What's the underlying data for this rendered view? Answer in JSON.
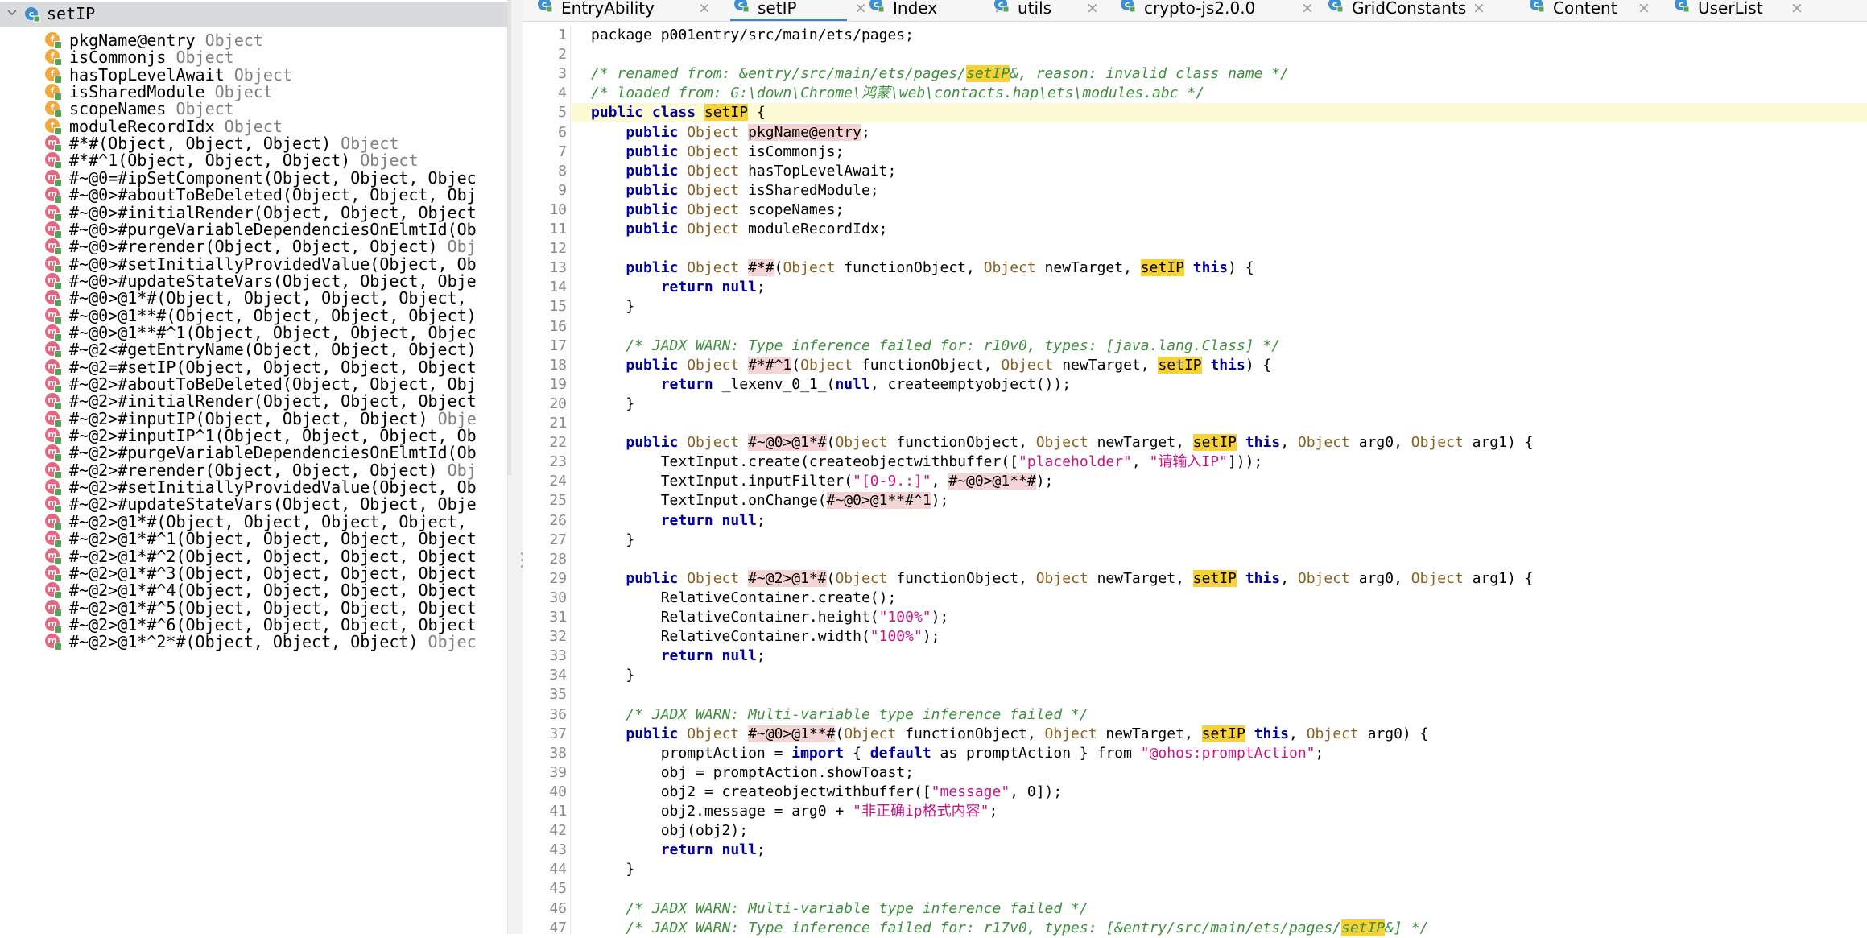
{
  "tree": {
    "root_label": "setIP",
    "items": [
      {
        "kind": "f",
        "name": "pkgName@entry",
        "type": "Object"
      },
      {
        "kind": "f",
        "name": "isCommonjs",
        "type": "Object"
      },
      {
        "kind": "f",
        "name": "hasTopLevelAwait",
        "type": "Object"
      },
      {
        "kind": "f",
        "name": "isSharedModule",
        "type": "Object"
      },
      {
        "kind": "f",
        "name": "scopeNames",
        "type": "Object"
      },
      {
        "kind": "f",
        "name": "moduleRecordIdx",
        "type": "Object"
      },
      {
        "kind": "m",
        "name": "#*#(Object, Object, Object)",
        "type": "Object"
      },
      {
        "kind": "m",
        "name": "#*#^1(Object, Object, Object)",
        "type": "Object"
      },
      {
        "kind": "m",
        "name": "#~@0=#ipSetComponent(Object, Object, Objec",
        "type": ""
      },
      {
        "kind": "m",
        "name": "#~@0>#aboutToBeDeleted(Object, Object, Obj",
        "type": ""
      },
      {
        "kind": "m",
        "name": "#~@0>#initialRender(Object, Object, Object",
        "type": ""
      },
      {
        "kind": "m",
        "name": "#~@0>#purgeVariableDependenciesOnElmtId(Ob",
        "type": ""
      },
      {
        "kind": "m",
        "name": "#~@0>#rerender(Object, Object, Object)",
        "type": "Obj"
      },
      {
        "kind": "m",
        "name": "#~@0>#setInitiallyProvidedValue(Object, Ob",
        "type": ""
      },
      {
        "kind": "m",
        "name": "#~@0>#updateStateVars(Object, Object, Obje",
        "type": ""
      },
      {
        "kind": "m",
        "name": "#~@0>@1*#(Object, Object, Object, Object,",
        "type": ""
      },
      {
        "kind": "m",
        "name": "#~@0>@1**#(Object, Object, Object, Object)",
        "type": ""
      },
      {
        "kind": "m",
        "name": "#~@0>@1**#^1(Object, Object, Object, Objec",
        "type": ""
      },
      {
        "kind": "m",
        "name": "#~@2<#getEntryName(Object, Object, Object)",
        "type": ""
      },
      {
        "kind": "m",
        "name": "#~@2=#setIP(Object, Object, Object, Object",
        "type": ""
      },
      {
        "kind": "m",
        "name": "#~@2>#aboutToBeDeleted(Object, Object, Obj",
        "type": ""
      },
      {
        "kind": "m",
        "name": "#~@2>#initialRender(Object, Object, Object",
        "type": ""
      },
      {
        "kind": "m",
        "name": "#~@2>#inputIP(Object, Object, Object)",
        "type": "Obje"
      },
      {
        "kind": "m",
        "name": "#~@2>#inputIP^1(Object, Object, Object, Ob",
        "type": ""
      },
      {
        "kind": "m",
        "name": "#~@2>#purgeVariableDependenciesOnElmtId(Ob",
        "type": ""
      },
      {
        "kind": "m",
        "name": "#~@2>#rerender(Object, Object, Object)",
        "type": "Obj"
      },
      {
        "kind": "m",
        "name": "#~@2>#setInitiallyProvidedValue(Object, Ob",
        "type": ""
      },
      {
        "kind": "m",
        "name": "#~@2>#updateStateVars(Object, Object, Obje",
        "type": ""
      },
      {
        "kind": "m",
        "name": "#~@2>@1*#(Object, Object, Object, Object,",
        "type": ""
      },
      {
        "kind": "m",
        "name": "#~@2>@1*#^1(Object, Object, Object, Object",
        "type": ""
      },
      {
        "kind": "m",
        "name": "#~@2>@1*#^2(Object, Object, Object, Object",
        "type": ""
      },
      {
        "kind": "m",
        "name": "#~@2>@1*#^3(Object, Object, Object, Object",
        "type": ""
      },
      {
        "kind": "m",
        "name": "#~@2>@1*#^4(Object, Object, Object, Object",
        "type": ""
      },
      {
        "kind": "m",
        "name": "#~@2>@1*#^5(Object, Object, Object, Object",
        "type": ""
      },
      {
        "kind": "m",
        "name": "#~@2>@1*#^6(Object, Object, Object, Object",
        "type": ""
      },
      {
        "kind": "m",
        "name": "#~@2>@1*^2*#(Object, Object, Object)",
        "type": "Objec"
      }
    ]
  },
  "tabs": [
    {
      "label": "EntryAbility",
      "active": false
    },
    {
      "label": "setIP",
      "active": true
    },
    {
      "label": "Index",
      "active": false
    },
    {
      "label": "utils",
      "active": false
    },
    {
      "label": "crypto-js2.0.0",
      "active": false
    },
    {
      "label": "GridConstants",
      "active": false
    },
    {
      "label": "Content",
      "active": false
    },
    {
      "label": "UserList",
      "active": false
    }
  ],
  "tab_close_glyph": "×",
  "editor": {
    "lines": [
      [
        {
          "t": "package p001entry/src/main/ets/pages;"
        }
      ],
      [],
      [
        {
          "c": "cm",
          "t": "/* renamed from: &entry/src/main/ets/pages/"
        },
        {
          "c": "cm hl",
          "t": "setIP"
        },
        {
          "c": "cm",
          "t": "&, reason: invalid class name */"
        }
      ],
      [
        {
          "c": "cm",
          "t": "/* loaded from: G:\\down\\Chrome\\鸿蒙\\web\\contacts.hap\\ets\\modules.abc */"
        }
      ],
      [
        {
          "c": "kw",
          "t": "public class "
        },
        {
          "c": "hl",
          "t": "setIP"
        },
        {
          "t": " {"
        }
      ],
      [
        {
          "t": "    "
        },
        {
          "c": "kw",
          "t": "public "
        },
        {
          "c": "ty",
          "t": "Object "
        },
        {
          "c": "pk",
          "t": "pkgName@entry"
        },
        {
          "t": ";"
        }
      ],
      [
        {
          "t": "    "
        },
        {
          "c": "kw",
          "t": "public "
        },
        {
          "c": "ty",
          "t": "Object "
        },
        {
          "t": "isCommonjs;"
        }
      ],
      [
        {
          "t": "    "
        },
        {
          "c": "kw",
          "t": "public "
        },
        {
          "c": "ty",
          "t": "Object "
        },
        {
          "t": "hasTopLevelAwait;"
        }
      ],
      [
        {
          "t": "    "
        },
        {
          "c": "kw",
          "t": "public "
        },
        {
          "c": "ty",
          "t": "Object "
        },
        {
          "t": "isSharedModule;"
        }
      ],
      [
        {
          "t": "    "
        },
        {
          "c": "kw",
          "t": "public "
        },
        {
          "c": "ty",
          "t": "Object "
        },
        {
          "t": "scopeNames;"
        }
      ],
      [
        {
          "t": "    "
        },
        {
          "c": "kw",
          "t": "public "
        },
        {
          "c": "ty",
          "t": "Object "
        },
        {
          "t": "moduleRecordIdx;"
        }
      ],
      [],
      [
        {
          "t": "    "
        },
        {
          "c": "kw",
          "t": "public "
        },
        {
          "c": "ty",
          "t": "Object "
        },
        {
          "c": "pk",
          "t": "#*#"
        },
        {
          "t": "("
        },
        {
          "c": "ty",
          "t": "Object "
        },
        {
          "t": "functionObject, "
        },
        {
          "c": "ty",
          "t": "Object "
        },
        {
          "t": "newTarget, "
        },
        {
          "c": "hl",
          "t": "setIP"
        },
        {
          "t": " "
        },
        {
          "c": "kw",
          "t": "this"
        },
        {
          "t": ") {"
        }
      ],
      [
        {
          "t": "        "
        },
        {
          "c": "kw",
          "t": "return null"
        },
        {
          "t": ";"
        }
      ],
      [
        {
          "t": "    }"
        }
      ],
      [],
      [
        {
          "t": "    "
        },
        {
          "c": "cm",
          "t": "/* JADX WARN: Type inference failed for: r10v0, types: [java.lang.Class] */"
        }
      ],
      [
        {
          "t": "    "
        },
        {
          "c": "kw",
          "t": "public "
        },
        {
          "c": "ty",
          "t": "Object "
        },
        {
          "c": "pk",
          "t": "#*#^1"
        },
        {
          "t": "("
        },
        {
          "c": "ty",
          "t": "Object "
        },
        {
          "t": "functionObject, "
        },
        {
          "c": "ty",
          "t": "Object "
        },
        {
          "t": "newTarget, "
        },
        {
          "c": "hl",
          "t": "setIP"
        },
        {
          "t": " "
        },
        {
          "c": "kw",
          "t": "this"
        },
        {
          "t": ") {"
        }
      ],
      [
        {
          "t": "        "
        },
        {
          "c": "kw",
          "t": "return "
        },
        {
          "t": "_lexenv_0_1_("
        },
        {
          "c": "kw",
          "t": "null"
        },
        {
          "t": ", createemptyobject());"
        }
      ],
      [
        {
          "t": "    }"
        }
      ],
      [],
      [
        {
          "t": "    "
        },
        {
          "c": "kw",
          "t": "public "
        },
        {
          "c": "ty",
          "t": "Object "
        },
        {
          "c": "pk",
          "t": "#~@0>@1*#"
        },
        {
          "t": "("
        },
        {
          "c": "ty",
          "t": "Object "
        },
        {
          "t": "functionObject, "
        },
        {
          "c": "ty",
          "t": "Object "
        },
        {
          "t": "newTarget, "
        },
        {
          "c": "hl",
          "t": "setIP"
        },
        {
          "t": " "
        },
        {
          "c": "kw",
          "t": "this"
        },
        {
          "t": ", "
        },
        {
          "c": "ty",
          "t": "Object "
        },
        {
          "t": "arg0, "
        },
        {
          "c": "ty",
          "t": "Object "
        },
        {
          "t": "arg1) {"
        }
      ],
      [
        {
          "t": "        TextInput.create(createobjectwithbuffer(["
        },
        {
          "c": "st",
          "t": "\"placeholder\""
        },
        {
          "t": ", "
        },
        {
          "c": "st",
          "t": "\"请输入IP\""
        },
        {
          "t": "]));"
        }
      ],
      [
        {
          "t": "        TextInput.inputFilter("
        },
        {
          "c": "st",
          "t": "\"[0-9.:]\""
        },
        {
          "t": ", "
        },
        {
          "c": "pk",
          "t": "#~@0>@1**#"
        },
        {
          "t": ");"
        }
      ],
      [
        {
          "t": "        TextInput.onChange("
        },
        {
          "c": "pk",
          "t": "#~@0>@1**#^1"
        },
        {
          "t": ");"
        }
      ],
      [
        {
          "t": "        "
        },
        {
          "c": "kw",
          "t": "return null"
        },
        {
          "t": ";"
        }
      ],
      [
        {
          "t": "    }"
        }
      ],
      [],
      [
        {
          "t": "    "
        },
        {
          "c": "kw",
          "t": "public "
        },
        {
          "c": "ty",
          "t": "Object "
        },
        {
          "c": "pk",
          "t": "#~@2>@1*#"
        },
        {
          "t": "("
        },
        {
          "c": "ty",
          "t": "Object "
        },
        {
          "t": "functionObject, "
        },
        {
          "c": "ty",
          "t": "Object "
        },
        {
          "t": "newTarget, "
        },
        {
          "c": "hl",
          "t": "setIP"
        },
        {
          "t": " "
        },
        {
          "c": "kw",
          "t": "this"
        },
        {
          "t": ", "
        },
        {
          "c": "ty",
          "t": "Object "
        },
        {
          "t": "arg0, "
        },
        {
          "c": "ty",
          "t": "Object "
        },
        {
          "t": "arg1) {"
        }
      ],
      [
        {
          "t": "        RelativeContainer.create();"
        }
      ],
      [
        {
          "t": "        RelativeContainer.height("
        },
        {
          "c": "st",
          "t": "\"100%\""
        },
        {
          "t": ");"
        }
      ],
      [
        {
          "t": "        RelativeContainer.width("
        },
        {
          "c": "st",
          "t": "\"100%\""
        },
        {
          "t": ");"
        }
      ],
      [
        {
          "t": "        "
        },
        {
          "c": "kw",
          "t": "return null"
        },
        {
          "t": ";"
        }
      ],
      [
        {
          "t": "    }"
        }
      ],
      [],
      [
        {
          "t": "    "
        },
        {
          "c": "cm",
          "t": "/* JADX WARN: Multi-variable type inference failed */"
        }
      ],
      [
        {
          "t": "    "
        },
        {
          "c": "kw",
          "t": "public "
        },
        {
          "c": "ty",
          "t": "Object "
        },
        {
          "c": "pk",
          "t": "#~@0>@1**#"
        },
        {
          "t": "("
        },
        {
          "c": "ty",
          "t": "Object "
        },
        {
          "t": "functionObject, "
        },
        {
          "c": "ty",
          "t": "Object "
        },
        {
          "t": "newTarget, "
        },
        {
          "c": "hl",
          "t": "setIP"
        },
        {
          "t": " "
        },
        {
          "c": "kw",
          "t": "this"
        },
        {
          "t": ", "
        },
        {
          "c": "ty",
          "t": "Object "
        },
        {
          "t": "arg0) {"
        }
      ],
      [
        {
          "t": "        promptAction = "
        },
        {
          "c": "kw",
          "t": "import "
        },
        {
          "t": "{ "
        },
        {
          "c": "kw",
          "t": "default "
        },
        {
          "t": "as promptAction } from "
        },
        {
          "c": "st",
          "t": "\"@ohos:promptAction\""
        },
        {
          "t": ";"
        }
      ],
      [
        {
          "t": "        obj = promptAction.showToast;"
        }
      ],
      [
        {
          "t": "        obj2 = createobjectwithbuffer(["
        },
        {
          "c": "st",
          "t": "\"message\""
        },
        {
          "t": ", 0]);"
        }
      ],
      [
        {
          "t": "        obj2.message = arg0 + "
        },
        {
          "c": "st",
          "t": "\"非正确ip格式内容\""
        },
        {
          "t": ";"
        }
      ],
      [
        {
          "t": "        obj(obj2);"
        }
      ],
      [
        {
          "t": "        "
        },
        {
          "c": "kw",
          "t": "return null"
        },
        {
          "t": ";"
        }
      ],
      [
        {
          "t": "    }"
        }
      ],
      [],
      [
        {
          "t": "    "
        },
        {
          "c": "cm",
          "t": "/* JADX WARN: Multi-variable type inference failed */"
        }
      ],
      [
        {
          "t": "    "
        },
        {
          "c": "cm",
          "t": "/* JADX WARN: Type inference failed for: r17v0, types: [&entry/src/main/ets/pages/"
        },
        {
          "c": "cm hl",
          "t": "setIP"
        },
        {
          "c": "cm",
          "t": "&] */"
        }
      ]
    ]
  }
}
